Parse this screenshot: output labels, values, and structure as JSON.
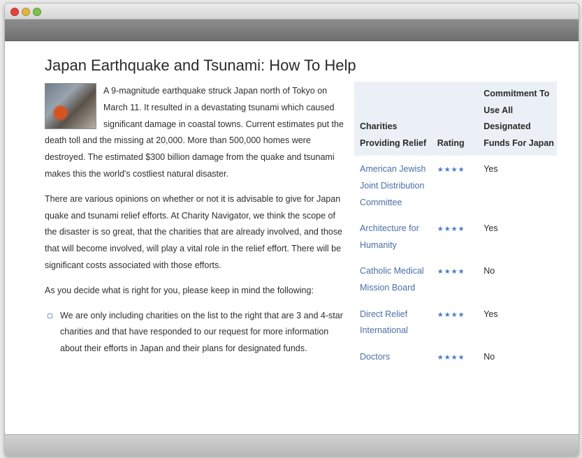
{
  "article": {
    "title": "Japan Earthquake and Tsunami: How To Help",
    "paragraphs": [
      "A 9-magnitude earthquake struck Japan north of Tokyo on March 11. It resulted in a devastating tsunami which caused significant damage in coastal towns. Current estimates put the death toll and the missing at 20,000. More than 500,000 homes were destroyed. The estimated $300 billion damage from the quake and tsunami makes this the world's costliest natural disaster.",
      "There are various opinions on whether or not it is advisable to give for Japan quake and tsunami relief efforts. At Charity Navigator, we think the scope of the disaster is so great, that the charities that are already involved, and those that will become involved, will play a vital role in the relief effort. There will be significant costs associated with those efforts.",
      "As you decide what is right for you, please keep in mind the following:"
    ],
    "bullets": [
      "We are only including charities on the list to the right that are 3 and 4-star charities and that have responded to our request for more information about their efforts in Japan and their plans for designated funds."
    ]
  },
  "table": {
    "headers": {
      "charities": "Charities Providing Relief",
      "rating": "Rating",
      "commitment": "Commitment To Use All Designated Funds For Japan"
    },
    "rows": [
      {
        "charity": "American Jewish Joint Distribution Committee",
        "rating": "★★★★",
        "commitment": "Yes"
      },
      {
        "charity": "Architecture for Humanity",
        "rating": "★★★★",
        "commitment": "Yes"
      },
      {
        "charity": "Catholic Medical Mission Board",
        "rating": "★★★★",
        "commitment": "No"
      },
      {
        "charity": "Direct Relief International",
        "rating": "★★★★",
        "commitment": "Yes"
      },
      {
        "charity": "Doctors",
        "rating": "★★★★",
        "commitment": "No"
      }
    ]
  },
  "colors": {
    "link": "#4a6fa8",
    "stars": "#4a7bc4",
    "header_bg": "#eaf0f6"
  }
}
